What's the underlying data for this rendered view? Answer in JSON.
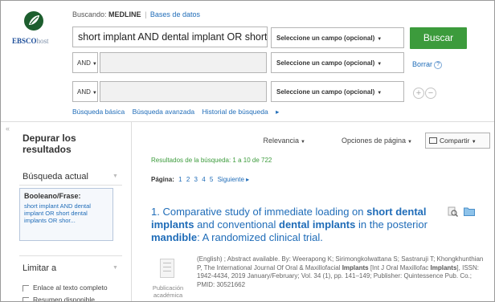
{
  "brand": {
    "logo_prefix": "EBSCO",
    "logo_suffix": "host",
    "brand_color": "#1d4e9a"
  },
  "header": {
    "searching_label": "Buscando:",
    "database": "MEDLINE",
    "separator": "|",
    "databases_link": "Bases de datos"
  },
  "search": {
    "main_query": "short implant AND dental implant OR short",
    "field_select_placeholder": "Seleccione un campo (opcional)",
    "bool_operator_2": "AND",
    "bool_operator_3": "AND",
    "submit_label": "Buscar",
    "clear_label": "Borrar",
    "links": [
      "Búsqueda básica",
      "Búsqueda avanzada",
      "Historial de búsqueda"
    ]
  },
  "sidebar": {
    "refine_title": "Depurar los resultados",
    "current_search_title": "Búsqueda actual",
    "boolean_heading": "Booleano/Frase:",
    "boolean_query": "short implant AND dental implant OR short dental implants OR shor...",
    "limit_title": "Limitar a",
    "limit_options": [
      "Enlace al texto completo",
      "Resumen disponible"
    ]
  },
  "toolbar": {
    "relevance_label": "Relevancia",
    "page_options_label": "Opciones de página",
    "share_label": "Compartir"
  },
  "results": {
    "count_text": "Resultados de la búsqueda: 1 a 10 de 722",
    "page_label": "Página:",
    "pages": [
      "1",
      "2",
      "3",
      "4",
      "5"
    ],
    "next_label": "Siguiente",
    "first_result": {
      "number": "1.",
      "title_part1": "Comparative study of immediate loading on ",
      "title_bold1": "short dental implants",
      "title_part2": " and conventional ",
      "title_bold2": "dental implants",
      "title_part3": " in the posterior ",
      "title_bold3": "mandible",
      "title_part4": ": A randomized clinical trial.",
      "citation_part1": "(English) ; Abstract available. By: Weerapong K; Sirimongkolwattana S; Sastraruji T; Khongkhunthian P, The International Journal Of Oral & Maxillofacial ",
      "citation_bold": "Implants",
      "citation_part2": " [Int J Oral Maxillofac ",
      "citation_bold2": "Implants",
      "citation_part3": "], ISSN: 1942-4434, 2019 January/February; Vol. 34 (1), pp. 141–149; Publisher: Quintessence Pub. Co.; PMID: 30521662",
      "pub_type": "Publicación académica"
    }
  },
  "colors": {
    "link": "#1f6cb8",
    "button_green": "#3c9b3c",
    "result_count_green": "#3c9b3c"
  }
}
